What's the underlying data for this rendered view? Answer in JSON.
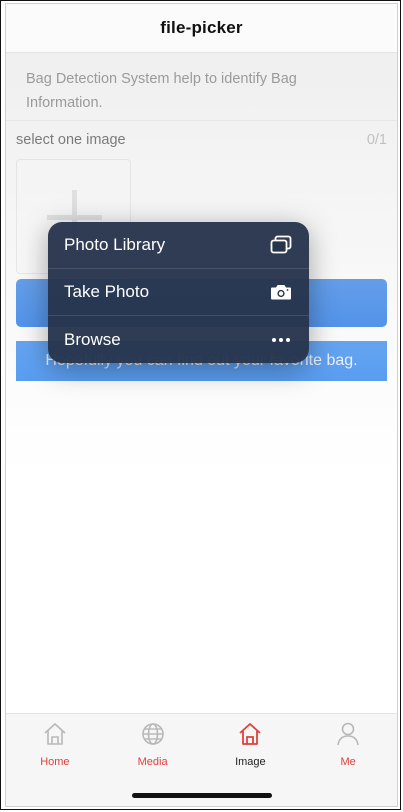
{
  "header": {
    "title": "file-picker"
  },
  "description": "Bag Detection System help to identify Bag Information.",
  "picker": {
    "label": "select one image",
    "count": "0/1"
  },
  "banner": {
    "text": "Hopefully you can find out your favorite bag."
  },
  "menu": {
    "items": [
      {
        "label": "Photo Library",
        "icon": "photo-library-icon"
      },
      {
        "label": "Take Photo",
        "icon": "camera-icon"
      },
      {
        "label": "Browse",
        "icon": "more-icon"
      }
    ]
  },
  "tabbar": {
    "tabs": [
      {
        "label": "Home",
        "icon": "home-icon",
        "color": "#e0403b"
      },
      {
        "label": "Media",
        "icon": "globe-icon",
        "color": "#e0403b"
      },
      {
        "label": "Image",
        "icon": "home-icon",
        "color": "#222222",
        "active": true
      },
      {
        "label": "Me",
        "icon": "user-icon",
        "color": "#e0403b"
      }
    ]
  },
  "colors": {
    "accent": "#1a73e8",
    "banner": "#3b8df2",
    "menu_bg": "#26344c",
    "tab_active_icon": "#e0403b",
    "tab_inactive_icon": "#b8b8b8"
  }
}
